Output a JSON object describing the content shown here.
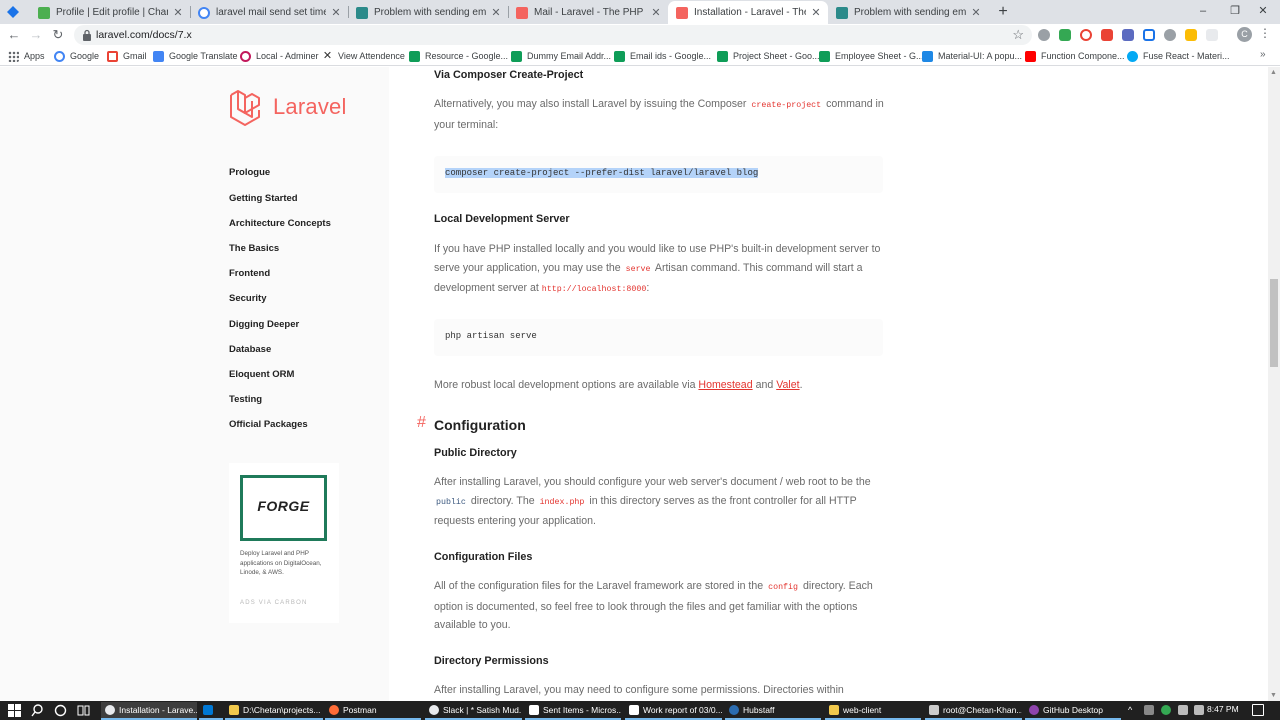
{
  "browser": {
    "tabs": [
      {
        "title": "",
        "color": "#1a73e8"
      },
      {
        "title": "Profile | Edit profile | Change pass",
        "color": "#4caf50"
      },
      {
        "title": "laravel mail send set timeout smt",
        "color": "#4285f4"
      },
      {
        "title": "Problem with sending emails | La",
        "color": "#2b8a8a"
      },
      {
        "title": "Mail - Laravel - The PHP Framew",
        "color": "#f4645f"
      },
      {
        "title": "Installation - Laravel - The PHP F",
        "color": "#f4645f"
      },
      {
        "title": "Problem with sending emails | La",
        "color": "#2b8a8a"
      }
    ],
    "active_tab_index": 5,
    "new_tab_label": "+",
    "window_controls": {
      "minimize": "–",
      "maximize": "❐",
      "close": "✕"
    },
    "url": "laravel.com/docs/7.x",
    "bookmarks": [
      {
        "label": "Apps",
        "icon": "apps-grid-icon",
        "color": "#5f6368"
      },
      {
        "label": "Google",
        "icon": "google-icon",
        "color": "#4285f4"
      },
      {
        "label": "Gmail",
        "icon": "gmail-icon",
        "color": "#ea4335"
      },
      {
        "label": "Google Translate",
        "icon": "translate-icon",
        "color": "#4285f4"
      },
      {
        "label": "Local - Adminer",
        "icon": "adminer-icon",
        "color": "#c2185b"
      },
      {
        "label": "View Attendence",
        "icon": "x-icon",
        "color": "#333333"
      },
      {
        "label": "Resource - Google...",
        "icon": "sheets-icon",
        "color": "#0f9d58"
      },
      {
        "label": "Dummy Email Addr...",
        "icon": "sheets-icon",
        "color": "#0f9d58"
      },
      {
        "label": "Email ids - Google...",
        "icon": "sheets-icon",
        "color": "#0f9d58"
      },
      {
        "label": "Project Sheet - Goo...",
        "icon": "sheets-icon",
        "color": "#0f9d58"
      },
      {
        "label": "Employee Sheet - G...",
        "icon": "sheets-icon",
        "color": "#0f9d58"
      },
      {
        "label": "Material-UI: A popu...",
        "icon": "material-ui-icon",
        "color": "#1e88e5"
      },
      {
        "label": "Function Compone...",
        "icon": "youtube-icon",
        "color": "#ff0000"
      },
      {
        "label": "Fuse React - Materi...",
        "icon": "fuse-icon",
        "color": "#03a9f4"
      }
    ],
    "profile_initial": "C"
  },
  "sidebar": {
    "logo_text": "Laravel",
    "nav": [
      "Prologue",
      "Getting Started",
      "Architecture Concepts",
      "The Basics",
      "Frontend",
      "Security",
      "Digging Deeper",
      "Database",
      "Eloquent ORM",
      "Testing",
      "Official Packages"
    ],
    "ad": {
      "logo_text": "FORGE",
      "description": "Deploy Laravel and PHP applications on DigitalOcean, Linode, & AWS.",
      "carbon": "ADS VIA CARBON"
    }
  },
  "content": {
    "via_composer": {
      "heading": "Via Composer Create-Project",
      "p_before": "Alternatively, you may also install Laravel by issuing the Composer",
      "code": "create-project",
      "p_after": "command in your terminal:",
      "codeblock": "composer create-project --prefer-dist laravel/laravel blog"
    },
    "local_server": {
      "heading": "Local Development Server",
      "p1": "If you have PHP installed locally and you would like to use PHP's built-in development server to serve your application, you may use the",
      "code": "serve",
      "p2": "Artisan command. This command will start a development server at",
      "url_code": "http://localhost:8000",
      "p3": ":",
      "codeblock": "php artisan serve",
      "more_before": "More robust local development options are available via",
      "homestead": "Homestead",
      "and": "and",
      "valet": "Valet",
      "more_after": "."
    },
    "configuration": {
      "hash": "#",
      "heading": "Configuration",
      "public_dir": {
        "heading": "Public Directory",
        "p1": "After installing Laravel, you should configure your web server's document / web root to be the",
        "code1": "public",
        "p2": "directory. The",
        "code2": "index.php",
        "p3": "in this directory serves as the front controller for all HTTP requests entering your application."
      },
      "config_files": {
        "heading": "Configuration Files",
        "p1": "All of the configuration files for the Laravel framework are stored in the",
        "code": "config",
        "p2": "directory. Each option is documented, so feel free to look through the files and get familiar with the options available to you."
      },
      "dir_permissions": {
        "heading": "Directory Permissions",
        "p1": "After installing Laravel, you may need to configure some permissions. Directories within"
      }
    }
  },
  "taskbar": {
    "items": [
      {
        "label": "Installation - Larave...",
        "color": "#e8eaed",
        "active": true
      },
      {
        "label": "",
        "color": "#0078d4",
        "active": false
      },
      {
        "label": "D:\\Chetan\\projects...",
        "color": "#f2c94c",
        "active": false
      },
      {
        "label": "Postman",
        "color": "#ff6c37",
        "active": false
      },
      {
        "label": "Slack | * Satish Mud...",
        "color": "#e8eaed",
        "active": false
      },
      {
        "label": "Sent Items - Micros...",
        "color": "#ffffff",
        "active": false
      },
      {
        "label": "Work report of 03/0...",
        "color": "#ffffff",
        "active": false
      },
      {
        "label": "Hubstaff",
        "color": "#2b6cb0",
        "active": false
      },
      {
        "label": "web-client",
        "color": "#f2c94c",
        "active": false
      },
      {
        "label": "root@Chetan-Khan...",
        "color": "#cccccc",
        "active": false
      },
      {
        "label": "GitHub Desktop",
        "color": "#8e44ad",
        "active": false
      }
    ],
    "clock": "8:47 PM"
  }
}
